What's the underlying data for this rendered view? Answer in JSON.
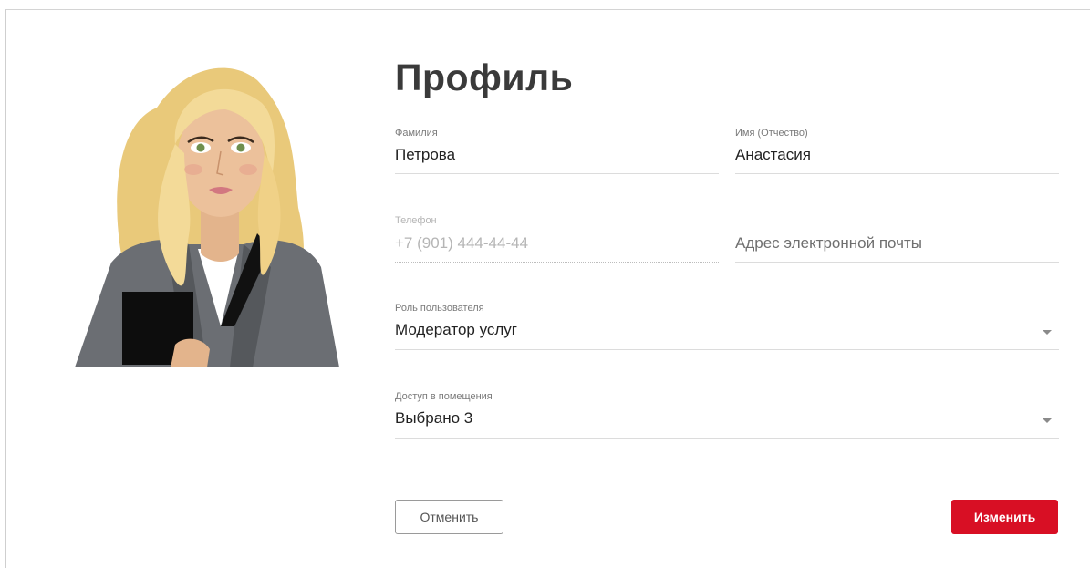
{
  "page": {
    "title": "Профиль"
  },
  "fields": {
    "last_name": {
      "label": "Фамилия",
      "value": "Петрова"
    },
    "first_name": {
      "label": "Имя (Отчество)",
      "value": "Анастасия"
    },
    "phone": {
      "label": "Телефон",
      "value": "+7 (901) 444-44-44"
    },
    "email": {
      "placeholder": "Адрес электронной почты"
    },
    "role": {
      "label": "Роль пользователя",
      "value": "Модератор услуг"
    },
    "access": {
      "label": "Доступ в помещения",
      "value": "Выбрано 3"
    }
  },
  "buttons": {
    "cancel": "Отменить",
    "save": "Изменить"
  },
  "colors": {
    "accent": "#d80f24",
    "title": "#3a3a3a",
    "divider": "#dcdcdc"
  }
}
